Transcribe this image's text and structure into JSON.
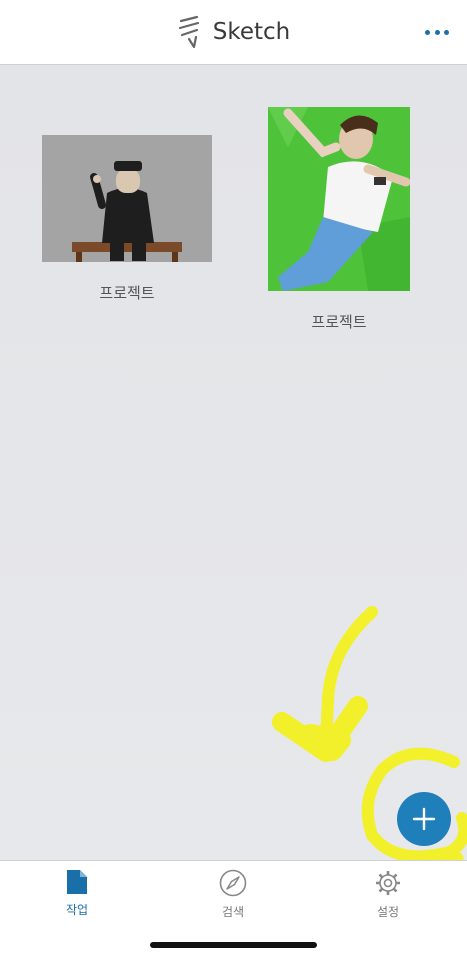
{
  "header": {
    "title": "Sketch",
    "more_icon": "more-dots-icon"
  },
  "projects": [
    {
      "label": "프로젝트",
      "thumbnail": "seated-figure-drawing"
    },
    {
      "label": "프로젝트",
      "thumbnail": "person-on-grass-drawing"
    }
  ],
  "fab": {
    "icon": "plus-icon"
  },
  "tabs": [
    {
      "label": "작업",
      "icon": "document-icon",
      "active": true
    },
    {
      "label": "검색",
      "icon": "compass-icon",
      "active": false
    },
    {
      "label": "설정",
      "icon": "gear-icon",
      "active": false
    }
  ],
  "colors": {
    "accent": "#1f7fba",
    "tab_active": "#1b6fa8",
    "highlight": "#f4f20a",
    "background": "#e6e7ea"
  }
}
